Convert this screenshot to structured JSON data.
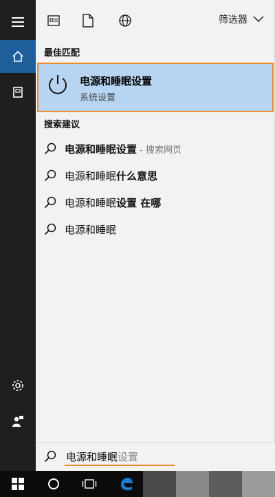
{
  "toolbar": {
    "filter_label": "筛选器"
  },
  "best_match": {
    "section_label": "最佳匹配",
    "title": "电源和睡眠设置",
    "subtitle": "系统设置"
  },
  "suggestions": {
    "section_label": "搜索建议",
    "items": [
      {
        "bold": "电源和睡眠设置",
        "normal": "",
        "hint": " - 搜索网页"
      },
      {
        "bold": "",
        "normal": "电源和睡眠",
        "extra_bold": "什么意思"
      },
      {
        "bold": "",
        "normal": "电源和睡眠",
        "extra_bold": "设置 在哪"
      },
      {
        "bold": "",
        "normal": "电源和睡眠",
        "extra_bold": ""
      }
    ]
  },
  "search": {
    "typed": "电源和睡眠",
    "autocomplete": "设置"
  },
  "colors": {
    "rail": "#1f1f1f",
    "rail_active": "#1e5f9a",
    "panel": "#f2f2f2",
    "highlight": "#b7d5f3",
    "accent_orange": "#f08a27",
    "edge_blue": "#1a7ad4"
  },
  "icons": {
    "rail": [
      "hamburger-icon",
      "home-icon",
      "notebook-icon",
      "settings-icon",
      "user-feedback-icon"
    ],
    "toolbar": [
      "apps-icon",
      "documents-icon",
      "web-icon",
      "chevron-down-icon"
    ],
    "taskbar": [
      "windows-logo-icon",
      "cortana-icon",
      "task-view-icon",
      "edge-icon"
    ]
  }
}
